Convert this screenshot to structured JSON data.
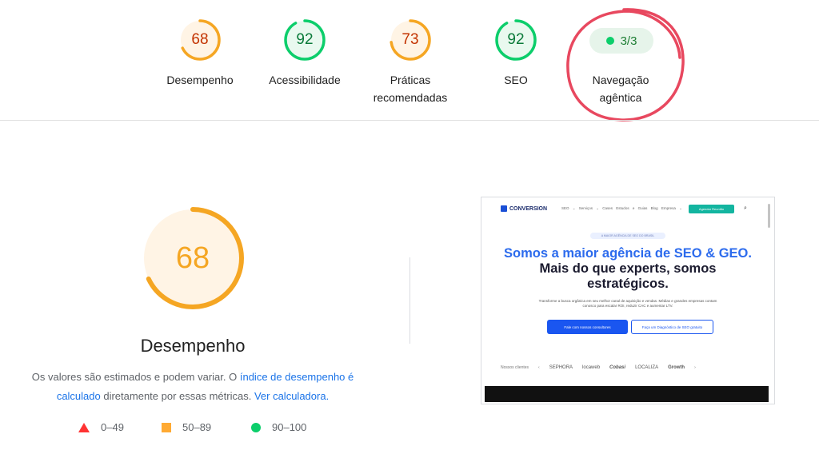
{
  "categories": [
    {
      "score": "68",
      "label_lines": [
        "Desempenho"
      ],
      "color": "#f5a623"
    },
    {
      "score": "92",
      "label_lines": [
        "Acessibilidade"
      ],
      "color": "#0cce6b"
    },
    {
      "score": "73",
      "label_lines": [
        "Práticas",
        "recomendadas"
      ],
      "color": "#f5a623"
    },
    {
      "score": "92",
      "label_lines": [
        "SEO"
      ],
      "color": "#0cce6b"
    }
  ],
  "agentic": {
    "score_text": "3/3",
    "label_lines": [
      "Navegação",
      "agêntica"
    ]
  },
  "main": {
    "score": "68",
    "score_fraction": 0.68,
    "title": "Desempenho",
    "desc": {
      "text1": "Os valores são estimados e podem variar. O ",
      "link1": "índice de desempenho é calculado",
      "text2": " diretamente por essas métricas. ",
      "link2": "Ver calculadora."
    }
  },
  "legend": [
    {
      "shape": "triangle",
      "range": "0–49",
      "color": "#ff3333"
    },
    {
      "shape": "square",
      "range": "50–89",
      "color": "#ffaa33"
    },
    {
      "shape": "circle",
      "range": "90–100",
      "color": "#0cce6b"
    }
  ],
  "thumbnail": {
    "logo": "CONVERSION",
    "nav_items": "SEO ⌄   Serviços ⌄   Cases   Estudos e Guias   Blog   Empresa ⌄",
    "cta": "Agendar Reunião",
    "badge": "A MAIOR AGÊNCIA DE SEO DO BRASIL",
    "h1_blue": "Somos a maior agência de SEO & GEO.",
    "h1_dark1": "Mais do que experts, somos",
    "h1_dark2": "estratégicos.",
    "sub": "Transforme a busca orgânica em seu melhor canal de aquisição e vendas. Médias e grandes empresas contam conosco para escalar ROI, reduzir CAC e aumentar LTV.",
    "btn1": "Fale com nossos consultores",
    "btn2": "Faça um Diagnóstico de SEO gratuito",
    "clients_label": "Nossos clientes",
    "clients": [
      "SEPHORA",
      "locaweb",
      "Cobasi",
      "LOCALIZA",
      "Growth"
    ]
  },
  "annotation_color": "#e8485f"
}
